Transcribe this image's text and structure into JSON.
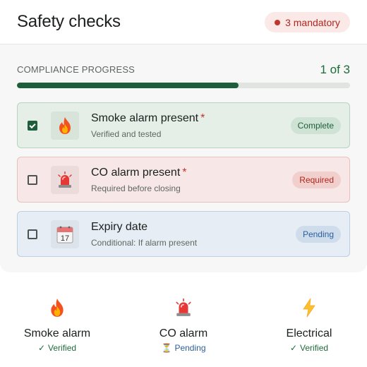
{
  "header": {
    "title": "Safety checks",
    "mandatory_badge": "3 mandatory"
  },
  "progress": {
    "label": "COMPLIANCE PROGRESS",
    "count": "1 of 3",
    "fraction": 0.665
  },
  "items": [
    {
      "title": "Smoke alarm present",
      "required_mark": "*",
      "subtitle": "Verified and tested",
      "status": "Complete",
      "checked": true,
      "icon": "fire-icon"
    },
    {
      "title": "CO alarm present",
      "required_mark": "*",
      "subtitle": "Required before closing",
      "status": "Required",
      "checked": false,
      "icon": "siren-icon"
    },
    {
      "title": "Expiry date",
      "subtitle": "Conditional: If alarm present",
      "status": "Pending",
      "checked": false,
      "icon": "calendar-icon",
      "calendar_day": "17"
    }
  ],
  "summary": [
    {
      "label": "Smoke alarm",
      "status_mark": "✓",
      "status": "Verified",
      "icon": "fire-icon"
    },
    {
      "label": "CO alarm",
      "status_mark": "⏳",
      "status": "Pending",
      "icon": "siren-icon"
    },
    {
      "label": "Electrical",
      "status_mark": "✓",
      "status": "Verified",
      "icon": "lightning-icon"
    }
  ],
  "colors": {
    "accent_green": "#1e5e3a",
    "required_red": "#c0362c",
    "pending_blue": "#2d5f9a"
  }
}
